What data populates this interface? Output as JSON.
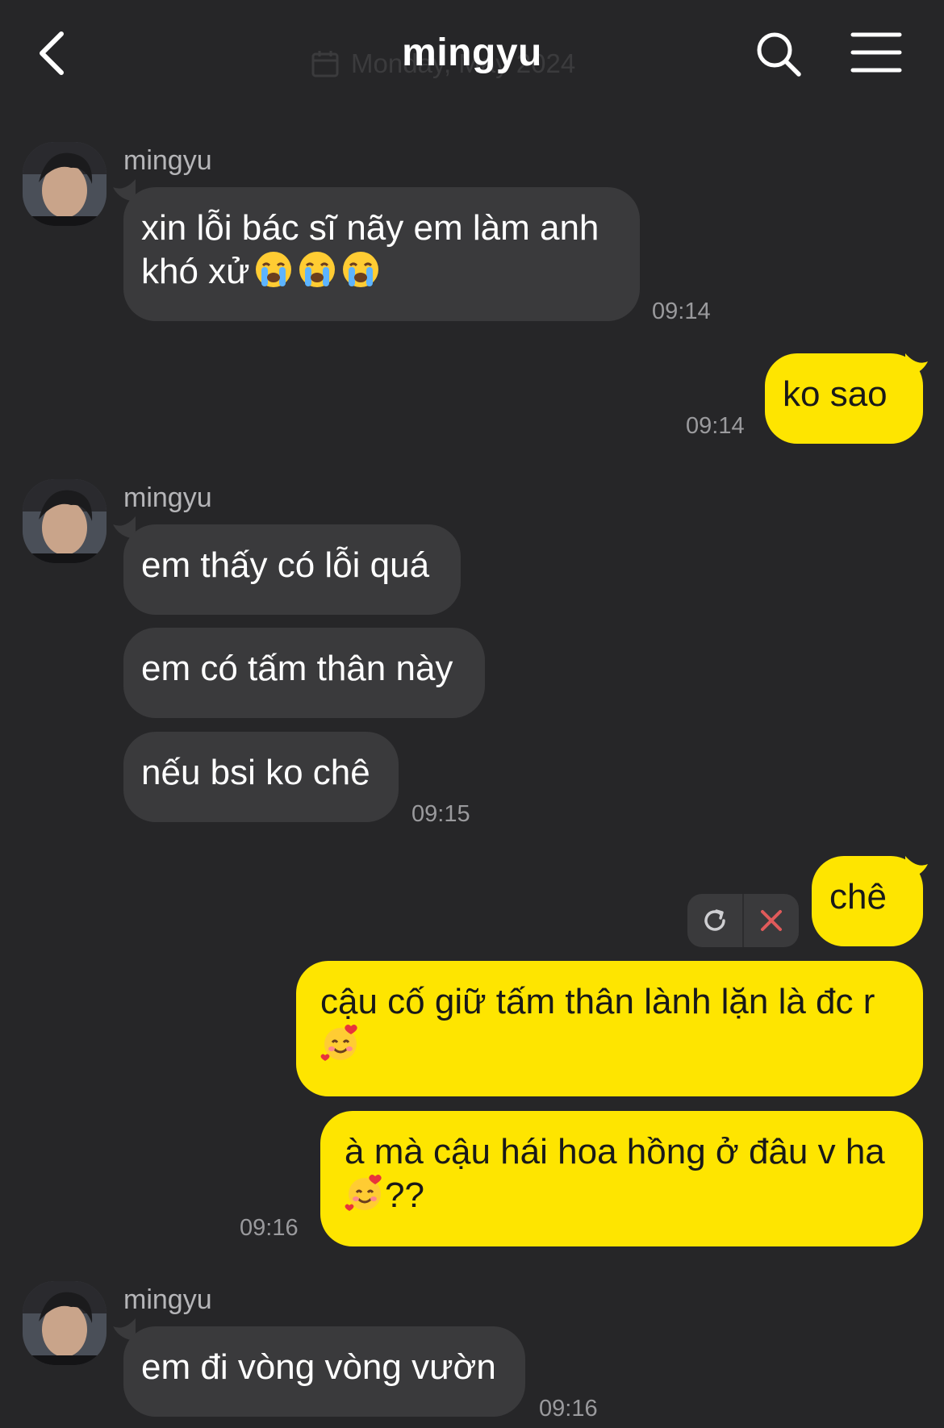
{
  "header": {
    "title": "mingyu",
    "date_ghost": "Monday, May 2024",
    "back_icon": "chevron-left-icon",
    "search_icon": "search-icon",
    "menu_icon": "hamburger-menu-icon"
  },
  "colors": {
    "background": "#262628",
    "incoming_bubble": "#3a3a3c",
    "outgoing_bubble": "#fee500",
    "timestamp": "#9a9a9d",
    "retry_cancel_x": "#e05a5a"
  },
  "messages": {
    "g1": {
      "sender": "mingyu",
      "m1_line1": "xin lỗi bác sĩ nãy em làm anh",
      "m1_line2": "khó xử",
      "m1_emojis": "😭😭😭",
      "time": "09:14"
    },
    "o1": {
      "text": "ko sao",
      "time": "09:14"
    },
    "g2": {
      "sender": "mingyu",
      "m1": "em thấy có lỗi quá",
      "m2": "em có tấm thân này",
      "m3": "nếu bsi ko chê",
      "time": "09:15"
    },
    "o2": {
      "m1": "chê",
      "m1_status": "failed",
      "retry_icon": "refresh-icon",
      "cancel_icon": "close-icon",
      "m2_line1": "cậu cố giữ tấm thân lành lặn là đc r",
      "m2_emoji": "🥰",
      "m3_line1": "à mà cậu hái hoa hồng ở đâu v ha",
      "m3_line2_suffix": "??",
      "m3_emoji": "🥰",
      "time": "09:16"
    },
    "g3": {
      "sender": "mingyu",
      "m1": "em đi vòng vòng vườn",
      "time": "09:16"
    }
  }
}
